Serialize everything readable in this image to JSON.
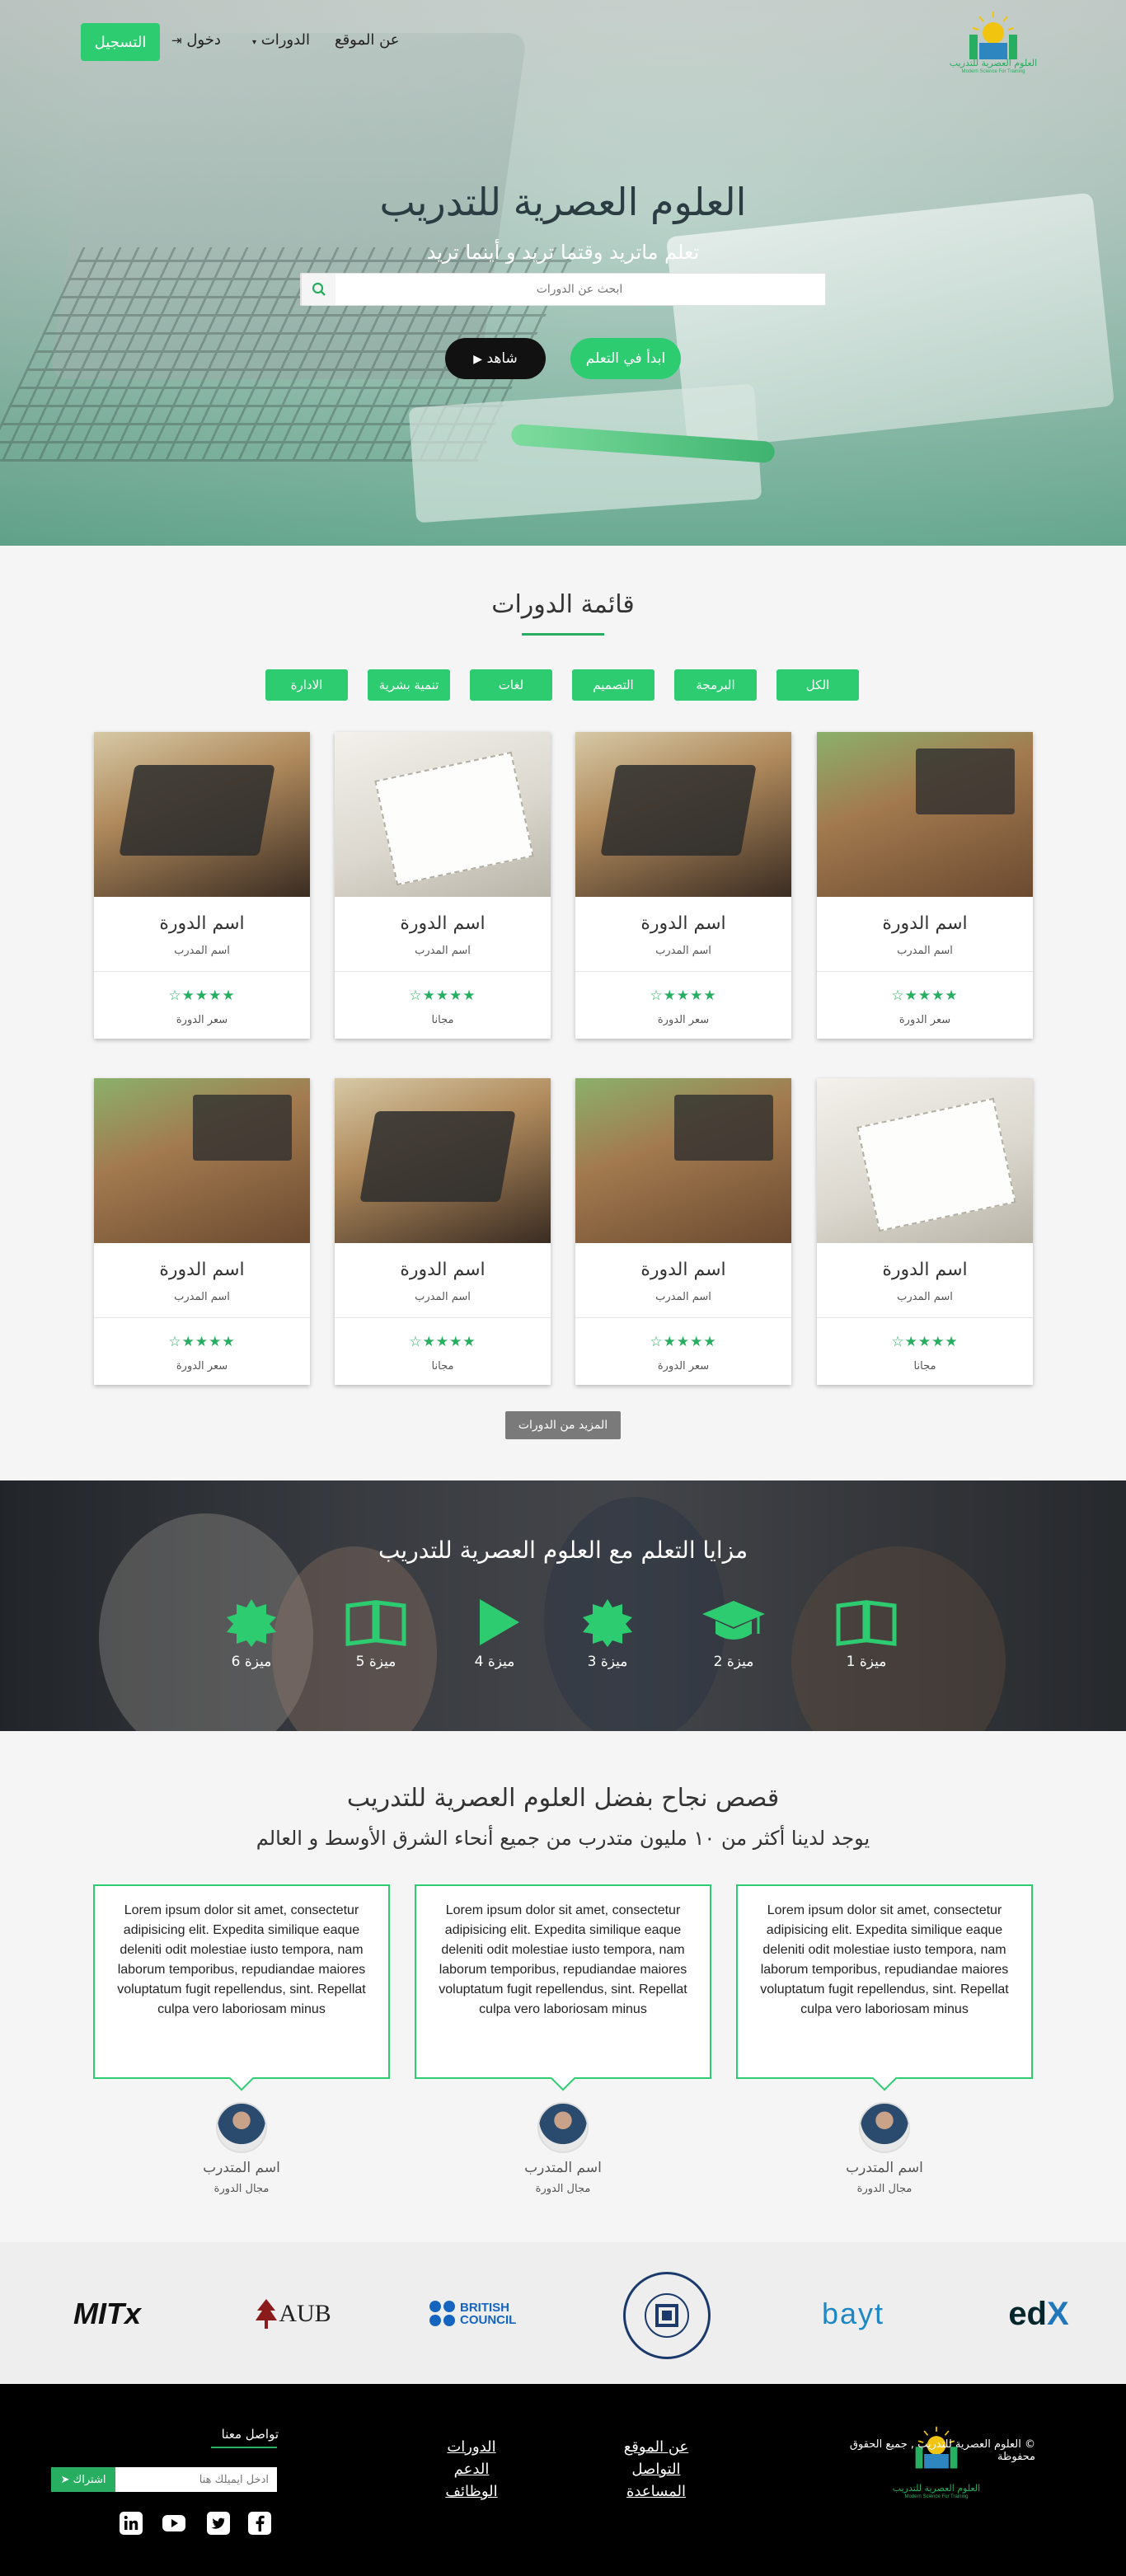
{
  "header": {
    "logo_text": "العلوم العصرية للتدريب",
    "logo_sub": "Modern Science For Training",
    "nav": {
      "about": "عن الموقع",
      "courses": "الدورات",
      "login": "دخول",
      "register": "التسجيل"
    }
  },
  "hero": {
    "title": "العلوم العصرية للتدريب",
    "subtitle": "تعلم ماتريد وقتما تريد و أينما تريد",
    "search_placeholder": "ابحث عن الدورات",
    "start_button": "ابدأ في التعلم",
    "watch_button": "شاهد"
  },
  "courses": {
    "title": "قائمة الدورات",
    "filters": [
      "الكل",
      "البرمجة",
      "التصميم",
      "لغات",
      "تنمية بشرية",
      "الادارة"
    ],
    "items": [
      {
        "name": "اسم الدورة",
        "trainer": "اسم المدرب",
        "rating": 5,
        "price": "سعر الدورة"
      },
      {
        "name": "اسم الدورة",
        "trainer": "اسم المدرب",
        "rating": 5,
        "price": "سعر الدورة"
      },
      {
        "name": "اسم الدورة",
        "trainer": "اسم المدرب",
        "rating": 5,
        "price": "مجانا"
      },
      {
        "name": "اسم الدورة",
        "trainer": "اسم المدرب",
        "rating": 5,
        "price": "سعر الدورة"
      },
      {
        "name": "اسم الدورة",
        "trainer": "اسم المدرب",
        "rating": 5,
        "price": "مجانا"
      },
      {
        "name": "اسم الدورة",
        "trainer": "اسم المدرب",
        "rating": 5,
        "price": "سعر الدورة"
      },
      {
        "name": "اسم الدورة",
        "trainer": "اسم المدرب",
        "rating": 5,
        "price": "مجانا"
      },
      {
        "name": "اسم الدورة",
        "trainer": "اسم المدرب",
        "rating": 5,
        "price": "سعر الدورة"
      }
    ],
    "more_button": "المزيد من الدورات"
  },
  "features": {
    "title": "مزايا التعلم مع العلوم العصرية للتدريب",
    "items": [
      {
        "label": "ميزة 1",
        "icon": "book-icon"
      },
      {
        "label": "ميزة 2",
        "icon": "graduation-cap-icon"
      },
      {
        "label": "ميزة 3",
        "icon": "badge-icon"
      },
      {
        "label": "ميزة 4",
        "icon": "play-icon"
      },
      {
        "label": "ميزة 5",
        "icon": "book-icon"
      },
      {
        "label": "ميزة 6",
        "icon": "badge-icon"
      }
    ]
  },
  "stories": {
    "title": "قصص نجاح بفضل العلوم العصرية للتدريب",
    "subtitle": "يوجد لدينا أكثر من ١٠ مليون متدرب من جميع أنحاء الشرق الأوسط و العالم",
    "items": [
      {
        "quote": "Lorem ipsum dolor sit amet, consectetur adipisicing elit. Expedita similique eaque deleniti odit molestiae iusto tempora, nam laborum temporibus, repudiandae maiores voluptatum fugit repellendus, sint. Repellat culpa vero laboriosam minus",
        "name": "اسم المتدرب",
        "field": "مجال الدورة"
      },
      {
        "quote": "Lorem ipsum dolor sit amet, consectetur adipisicing elit. Expedita similique eaque deleniti odit molestiae iusto tempora, nam laborum temporibus, repudiandae maiores voluptatum fugit repellendus, sint. Repellat culpa vero laboriosam minus",
        "name": "اسم المتدرب",
        "field": "مجال الدورة"
      },
      {
        "quote": "Lorem ipsum dolor sit amet, consectetur adipisicing elit. Expedita similique eaque deleniti odit molestiae iusto tempora, nam laborum temporibus, repudiandae maiores voluptatum fugit repellendus, sint. Repellat culpa vero laboriosam minus",
        "name": "اسم المتدرب",
        "field": "مجال الدورة"
      }
    ]
  },
  "partners": [
    "edX",
    "bayt",
    "Holy Spirit University of Kaslik",
    "BRITISH COUNCIL",
    "AUB",
    "MITx"
  ],
  "footer": {
    "links_col1": [
      "عن الموقع",
      "التواصل",
      "المساعدة"
    ],
    "links_col2": [
      "الدورات",
      "الدعم",
      "الوظائف"
    ],
    "newsletter_title": "تواصل معنا",
    "newsletter_placeholder": "ادخل ايميلك هنا",
    "subscribe": "اشتراك",
    "copyright": "© العلوم العصرية للتدريب , جميع الحقوق محفوظة",
    "social": [
      "facebook-icon",
      "twitter-icon",
      "youtube-icon",
      "linkedin-icon"
    ]
  },
  "colors": {
    "accent": "#2ecc71",
    "accent_dark": "#27ae60",
    "footer_bg": "#000000"
  }
}
